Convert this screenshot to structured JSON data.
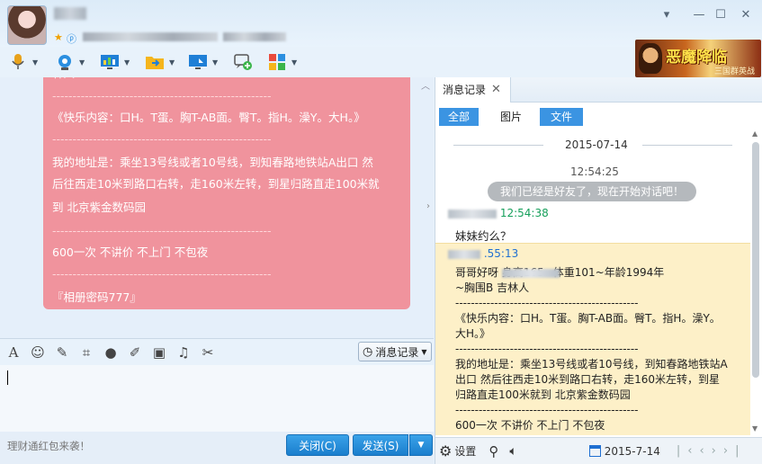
{
  "window": {
    "controls": [
      "▾",
      "—",
      "☐",
      "✕"
    ]
  },
  "banner": {
    "title": "恶魔降临",
    "subtitle": "三国群英战"
  },
  "chat_bubble": {
    "lines": [
      "林人",
      "------------------------------------------------------",
      "《快乐内容：口H。T蛋。胸T-AB面。臀T。指H。澡Y。大H。》",
      "------------------------------------------------------",
      "我的地址是：乘坐13号线或者10号线，到知春路地铁站A出口 然",
      "后往西走10米到路口右转，走160米左转，到星归路直走100米就",
      "到 北京紫金数码园",
      "------------------------------------------------------",
      "600一次 不讲价  不上门 不包夜",
      "------------------------------------------------------",
      "『相册密码777』"
    ]
  },
  "input": {
    "history_button_label": "消息记录",
    "promo_text": "理财通红包来袭！",
    "close_label": "关闭(C)",
    "send_label": "发送(S)"
  },
  "right_panel": {
    "tab_label": "消息记录",
    "filters": [
      "全部",
      "图片",
      "文件"
    ],
    "date": "2015-07-14",
    "system_time": "12:54:25",
    "system_message": "我们已经是好友了，现在开始对话吧！",
    "msg1_time": "12:54:38",
    "msg1_text": "妹妹约么？",
    "msg2_time": ".55:13",
    "msg2_lines": [
      "哥哥好呀                      身高165~体重101~年龄1994年",
      "~胸围B 吉林人",
      "-----------------------------------------------",
      "《快乐内容：口H。T蛋。胸T-AB面。臀T。指H。澡Y。",
      "大H。》",
      "-----------------------------------------------",
      "我的地址是：乘坐13号线或者10号线，到知春路地铁站A",
      "出口 然后往西走10米到路口右转，走160米左转，到星",
      "归路直走100米就到 北京紫金数码园",
      "-----------------------------------------------",
      "600一次 不讲价  不上门 不包夜"
    ],
    "settings_label": "设置",
    "footer_date": "2015-7-14"
  }
}
